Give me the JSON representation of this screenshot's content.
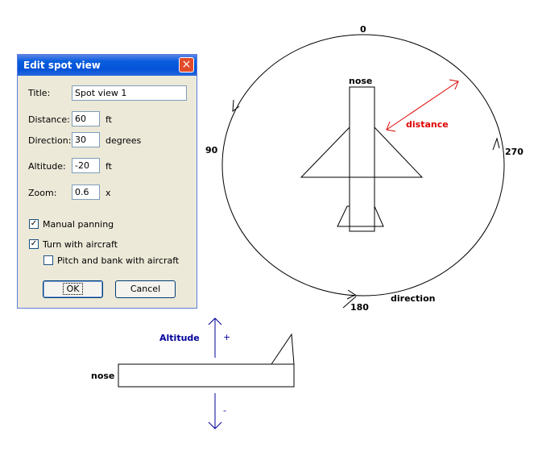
{
  "dialog": {
    "title": "Edit spot view",
    "close_glyph": "×",
    "fields": {
      "title": {
        "label": "Title:",
        "value": "Spot view 1"
      },
      "distance": {
        "label": "Distance:",
        "value": "60",
        "unit": "ft"
      },
      "direction": {
        "label": "Direction:",
        "value": "30",
        "unit": "degrees"
      },
      "altitude": {
        "label": "Altitude:",
        "value": "-20",
        "unit": "ft"
      },
      "zoom": {
        "label": "Zoom:",
        "value": "0.6",
        "unit": "x"
      }
    },
    "checkboxes": {
      "manual_panning": {
        "label": "Manual panning",
        "checked": true
      },
      "turn_with_aircraft": {
        "label": "Turn with aircraft",
        "checked": true
      },
      "pitch_and_bank": {
        "label": "Pitch and bank with aircraft",
        "checked": false
      }
    },
    "ok_label": "OK",
    "cancel_label": "Cancel",
    "check_glyph": "✓"
  },
  "top_view": {
    "heading_0": "0",
    "heading_90": "90",
    "heading_180": "180",
    "heading_270": "270",
    "nose_label": "nose",
    "distance_label": "distance",
    "direction_label": "direction"
  },
  "side_view": {
    "altitude_label": "Altitude",
    "plus_label": "+",
    "minus_label": "-",
    "nose_label": "nose"
  },
  "colors": {
    "distance_red": "#dd0000",
    "altitude_blue": "#000099"
  }
}
